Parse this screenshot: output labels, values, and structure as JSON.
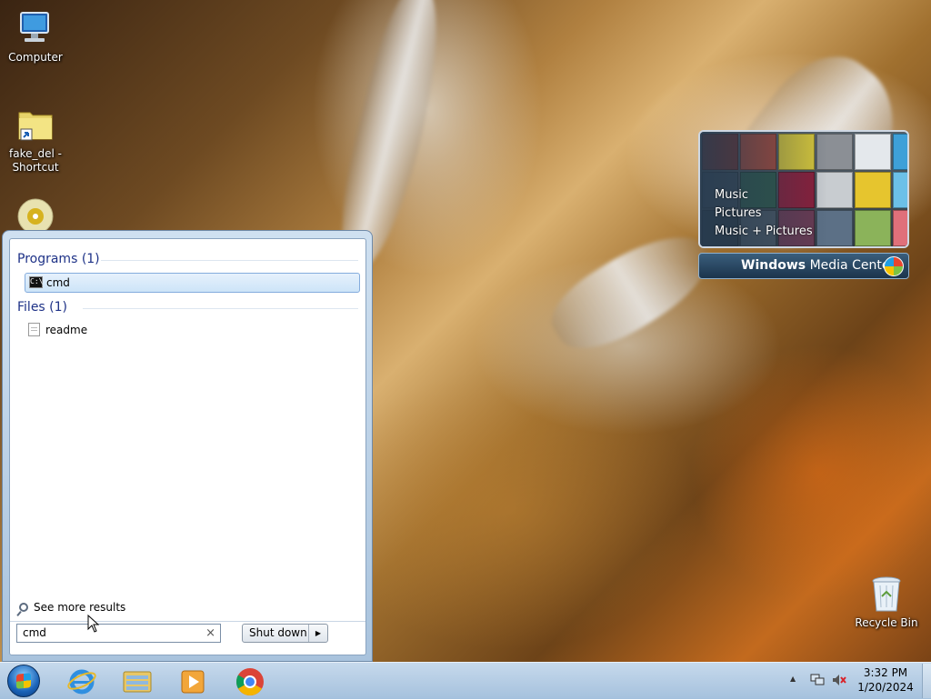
{
  "desktop": {
    "icons": [
      {
        "label": "Computer"
      },
      {
        "label": "fake_del - Shortcut"
      },
      {
        "label": "Recycle Bin"
      }
    ]
  },
  "media_center": {
    "items": [
      "Music",
      "Pictures",
      "Music + Pictures"
    ],
    "brand_bold": "Windows",
    "brand_rest": "Media Center"
  },
  "start_menu": {
    "programs_header": "Programs (1)",
    "programs": [
      {
        "label": "cmd",
        "icon": "cmd-icon"
      }
    ],
    "files_header": "Files (1)",
    "files": [
      {
        "label": "readme",
        "icon": "text-file-icon"
      }
    ],
    "see_more": "See more results",
    "search_value": "cmd",
    "search_clear": "×",
    "shutdown_label": "Shut down",
    "shutdown_arrow": "▶"
  },
  "taskbar": {
    "pinned": [
      "internet-explorer-icon",
      "windows-explorer-icon",
      "media-player-icon",
      "chrome-icon"
    ],
    "clock_time": "3:32 PM",
    "clock_date": "1/20/2024",
    "tray_expand": "▲"
  },
  "colors": {
    "header_blue": "#1e3287",
    "selection_border": "#84acdd",
    "taskbar": "#b4cde6"
  }
}
